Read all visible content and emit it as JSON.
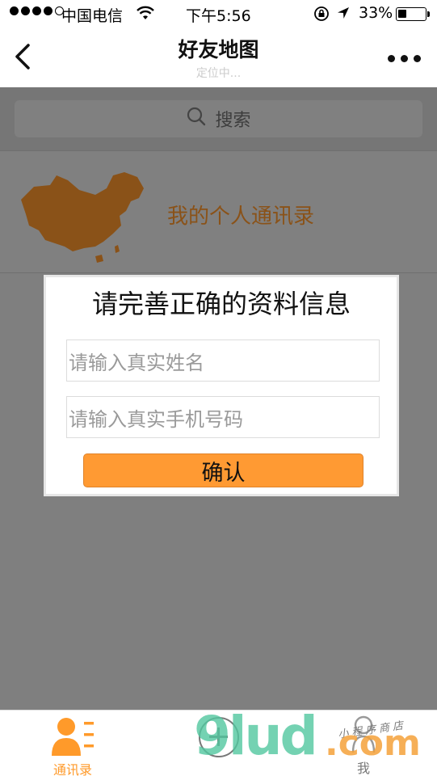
{
  "status_bar": {
    "carrier": "中国电信",
    "time": "下午5:56",
    "battery_percent": "33%",
    "battery_level": 0.33,
    "signal_bars_filled": 4,
    "signal_bars_total": 5
  },
  "navbar": {
    "title": "好友地图",
    "subtitle": "定位中..."
  },
  "search": {
    "placeholder": "搜索"
  },
  "contact_entry": {
    "label": "我的个人通讯录"
  },
  "dialog": {
    "title": "请完善正确的资料信息",
    "name_placeholder": "请输入真实姓名",
    "phone_placeholder": "请输入真实手机号码",
    "confirm_label": "确认"
  },
  "tabbar": {
    "contacts_label": "通讯录",
    "me_label": "我",
    "active_color": "#ff9a2a"
  },
  "watermark": {
    "site": "9lud",
    "tld": ".com",
    "store": "小程序商店"
  },
  "colors": {
    "accent": "#ff9a33",
    "overlay": "#7f7f7f"
  }
}
